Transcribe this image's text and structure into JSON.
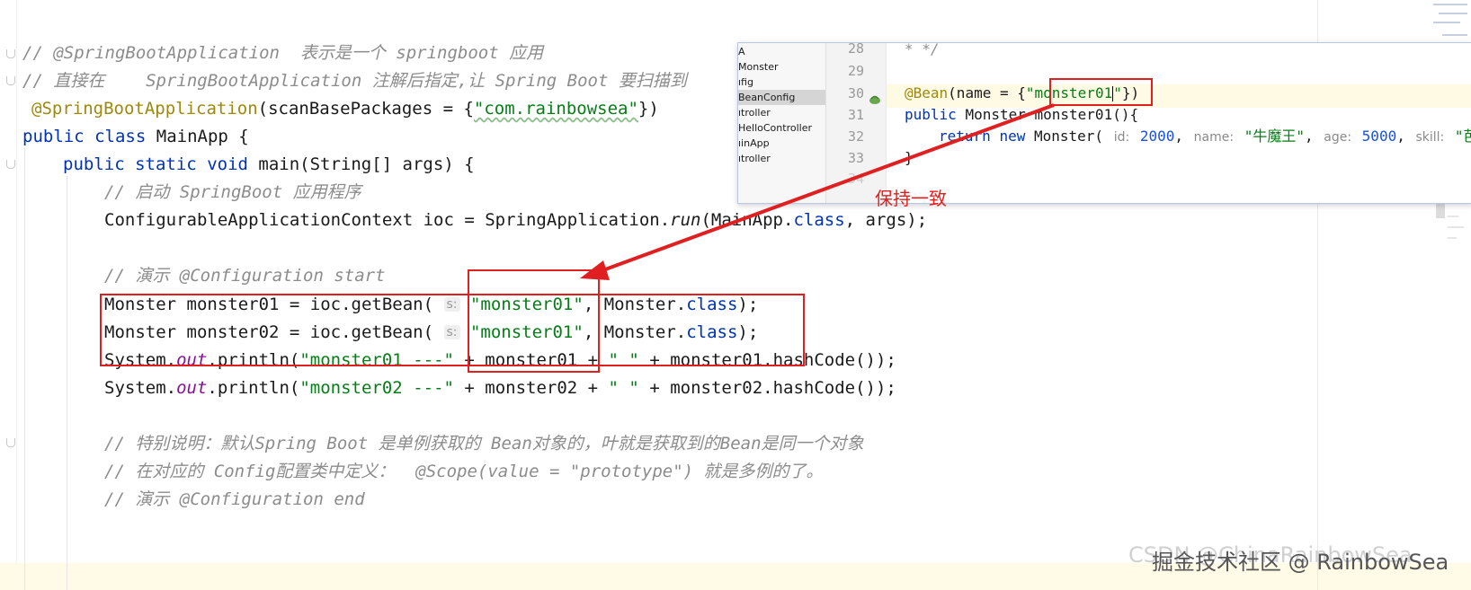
{
  "editor": {
    "lines": {
      "l1": "// @SpringBootApplication  表示是一个 springboot 应用",
      "l2": "// 直接在    SpringBootApplication 注解后指定,让 Spring Boot 要扫描到",
      "l3_ann": "@SpringBootApplication",
      "l3_a": "(scanBasePackages = {",
      "l3_str": "\"com.rainbowsea\"",
      "l3_b": "})",
      "l4_kw1": "public",
      "l4_kw2": "class",
      "l4_name": "MainApp {",
      "l5_kw1": "public",
      "l5_kw2": "static",
      "l5_kw3": "void",
      "l5_rest": "main(String[] args) {",
      "l6": "// 启动 SpringBoot 应用程序",
      "l7_a": "ConfigurableApplicationContext ioc = SpringApplication.",
      "l7_m": "run",
      "l7_b": "(MainApp.",
      "l7_kw": "class",
      "l7_c": ", args);",
      "l8": "// 演示 @Configuration start",
      "l9_a": "Monster monster01 = ioc.getBean( ",
      "l9_hint": "s:",
      "l9_str": "\"monster01\"",
      "l9_b": ", Monster.",
      "l9_kw": "class",
      "l9_c": ");",
      "l10_a": "Monster monster02 = ioc.getBean( ",
      "l10_hint": "s:",
      "l10_str": "\"monster01\"",
      "l10_b": ", Monster.",
      "l10_kw": "class",
      "l10_c": ");",
      "l11_a": "System.",
      "l11_out": "out",
      "l11_b": ".println(",
      "l11_str": "\"monster01 ---\"",
      "l11_c": " + monster01 + ",
      "l11_sp": "\" \"",
      "l11_d": " + monster01.hashCode());",
      "l12_a": "System.",
      "l12_out": "out",
      "l12_b": ".println(",
      "l12_str": "\"monster02 ---\"",
      "l12_c": " + monster02 + ",
      "l12_sp": "\" \"",
      "l12_d": " + monster02.hashCode());",
      "l13": "// 特别说明：默认Spring Boot 是单例获取的 Bean对象的，叶就是获取到的Bean是同一个对象",
      "l14": "// 在对应的 Config配置类中定义：  @Scope(value = \"prototype\") 就是多例的了。",
      "l15": "// 演示 @Configuration end"
    }
  },
  "popup": {
    "tree_items": [
      "A",
      "Monster",
      "ıfig",
      "BeanConfig",
      "ıtroller",
      "HelloController",
      "ıinApp",
      "ıtroller"
    ],
    "selected_index": 3,
    "line_numbers": [
      "28",
      "29",
      "30",
      "31",
      "32",
      "33",
      "34"
    ],
    "code": {
      "p28": "* */",
      "p30_ann": "@Bean",
      "p30_a": "(name = {",
      "p30_str1": "\"monster01",
      "p30_str2": "\"",
      "p30_b": "})",
      "p31_kw": "public",
      "p31_rest": "Monster monster01(){",
      "p32_kw1": "return",
      "p32_kw2": "new",
      "p32_a": "Monster(",
      "p32_h1": "id:",
      "p32_n1": "2000",
      "p32_h2": "name:",
      "p32_s2": "\"牛魔王\"",
      "p32_h3": "age:",
      "p32_n3": "5000",
      "p32_h4": "skill:",
      "p32_s4": "\"芭",
      "p33": "}"
    }
  },
  "annotation": {
    "label": "保持一致",
    "color": "#e02020"
  },
  "watermark": {
    "front": "掘金技术社区 @ RainbowSea",
    "back": "CSDN @ChinaRainbowSea"
  }
}
